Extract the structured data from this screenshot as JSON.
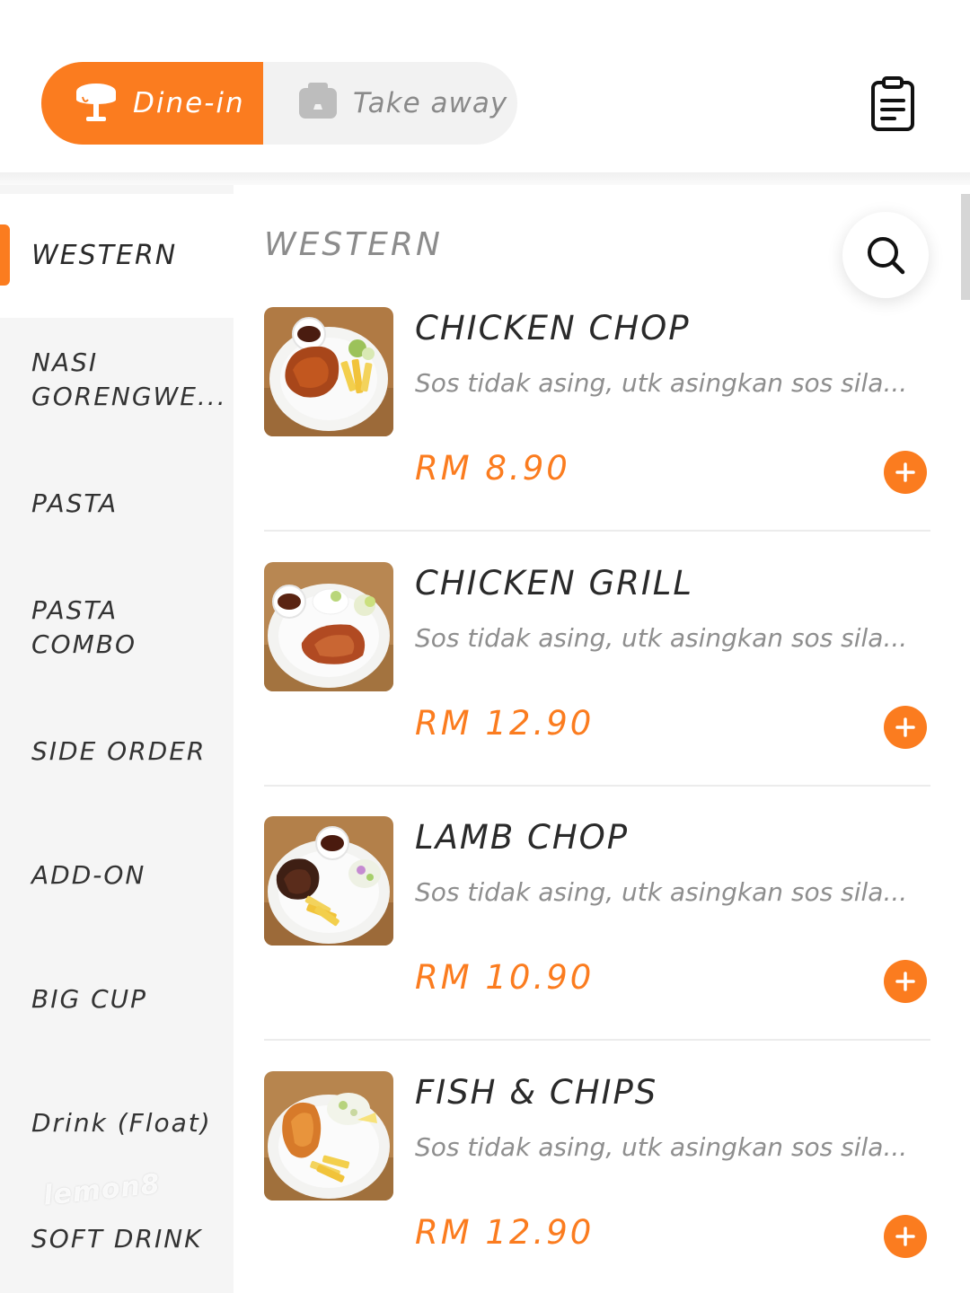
{
  "header": {
    "order_type_tabs": [
      {
        "label": "Dine-in",
        "icon": "dining-table-icon",
        "active": true
      },
      {
        "label": "Take away",
        "icon": "takeaway-bag-icon",
        "active": false
      }
    ],
    "orders_icon": "clipboard-icon"
  },
  "colors": {
    "accent": "#fb7c1f",
    "sidebar_bg": "#f5f5f5",
    "muted_text": "#8e8e8e",
    "brand_red": "#e5232a"
  },
  "sidebar": {
    "categories": [
      {
        "label": "WESTERN",
        "active": true
      },
      {
        "label": "NASI GORENGWE...",
        "active": false
      },
      {
        "label": "PASTA",
        "active": false
      },
      {
        "label": "PASTA COMBO",
        "active": false
      },
      {
        "label": "SIDE ORDER",
        "active": false
      },
      {
        "label": "ADD-ON",
        "active": false
      },
      {
        "label": "BIG CUP",
        "active": false
      },
      {
        "label": "Drink (Float)",
        "active": false
      },
      {
        "label": "SOFT DRINK",
        "active": false
      }
    ],
    "watermark": "lemon8"
  },
  "main": {
    "section_title": "WESTERN",
    "search_icon": "search-icon",
    "items": [
      {
        "name": "CHICKEN CHOP",
        "description": "Sos tidak asing, utk asingkan sos sila...",
        "price": "RM 8.90",
        "add_icon": "plus-icon"
      },
      {
        "name": "CHICKEN GRILL",
        "description": "Sos tidak asing, utk asingkan sos sila...",
        "price": "RM 12.90",
        "add_icon": "plus-icon"
      },
      {
        "name": "LAMB CHOP",
        "description": "Sos tidak asing, utk asingkan sos sila...",
        "price": "RM 10.90",
        "add_icon": "plus-icon"
      },
      {
        "name": "FISH & CHIPS",
        "description": "Sos tidak asing, utk asingkan sos sila...",
        "price": "RM 12.90",
        "add_icon": "plus-icon"
      }
    ]
  }
}
